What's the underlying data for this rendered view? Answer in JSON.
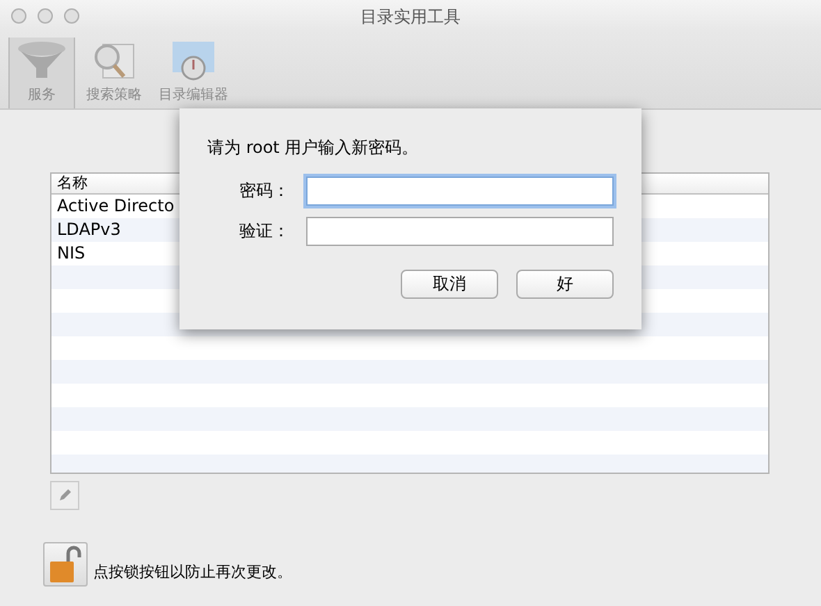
{
  "window": {
    "title": "目录实用工具"
  },
  "toolbar": [
    {
      "label": "服务",
      "selected": true,
      "kind": "services"
    },
    {
      "label": "搜索策略",
      "selected": false,
      "kind": "search"
    },
    {
      "label": "目录编辑器",
      "selected": false,
      "kind": "editor"
    }
  ],
  "table": {
    "columns": [
      "名称"
    ],
    "rows": [
      "Active Directo",
      "LDAPv3",
      "NIS"
    ]
  },
  "dialog": {
    "message": "请为 root 用户输入新密码。",
    "fields": [
      {
        "label": "密码：",
        "focused": true
      },
      {
        "label": "验证：",
        "focused": false
      }
    ],
    "buttons": [
      "取消",
      "好"
    ]
  },
  "lock": {
    "message": "点按锁按钮以防止再次更改。"
  }
}
